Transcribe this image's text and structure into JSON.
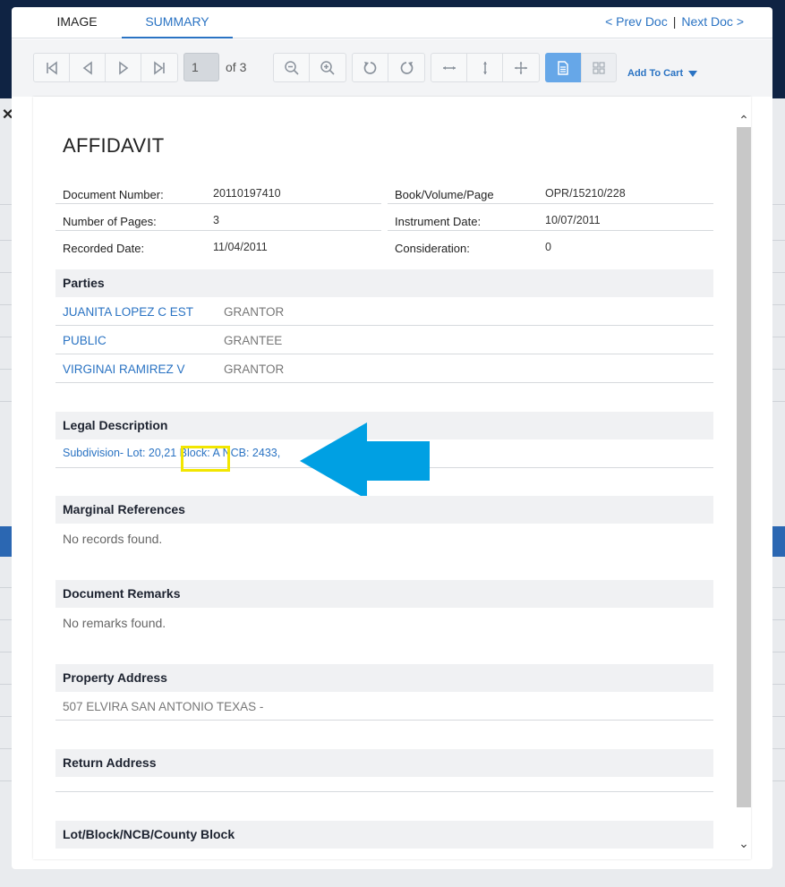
{
  "tabs": {
    "image": "IMAGE",
    "summary": "SUMMARY"
  },
  "docnav": {
    "prev": "< Prev Doc",
    "separator": "|",
    "next": "Next Doc >"
  },
  "toolbar": {
    "page_value": "1",
    "page_of": "of 3",
    "add_to_cart": "Add To Cart"
  },
  "document": {
    "title": "AFFIDAVIT",
    "fields_left": [
      {
        "label": "Document Number:",
        "value": "20110197410"
      },
      {
        "label": "Number of Pages:",
        "value": "3"
      },
      {
        "label": "Recorded Date:",
        "value": "11/04/2011"
      }
    ],
    "fields_right": [
      {
        "label": "Book/Volume/Page",
        "value": "OPR/15210/228"
      },
      {
        "label": "Instrument Date:",
        "value": "10/07/2011"
      },
      {
        "label": "Consideration:",
        "value": "0"
      }
    ]
  },
  "parties": {
    "heading": "Parties",
    "rows": [
      {
        "name": "JUANITA LOPEZ C EST",
        "role": "GRANTOR"
      },
      {
        "name": "PUBLIC",
        "role": "GRANTEE"
      },
      {
        "name": "VIRGINAI RAMIREZ V",
        "role": "GRANTOR"
      }
    ]
  },
  "legal_description": {
    "heading": "Legal Description",
    "text": "Subdivision- Lot: 20,21 Block: A NCB: 2433,"
  },
  "marginal_references": {
    "heading": "Marginal References",
    "empty": "No records found."
  },
  "document_remarks": {
    "heading": "Document Remarks",
    "empty": "No remarks found."
  },
  "property_address": {
    "heading": "Property Address",
    "text": "507 ELVIRA SAN ANTONIO TEXAS -"
  },
  "return_address": {
    "heading": "Return Address"
  },
  "lot_block": {
    "heading": "Lot/Block/NCB/County Block"
  },
  "colors": {
    "accent": "#2a73c3",
    "arrow": "#00a0e3",
    "highlight": "#f2e600",
    "active_view": "#66a7e8"
  }
}
